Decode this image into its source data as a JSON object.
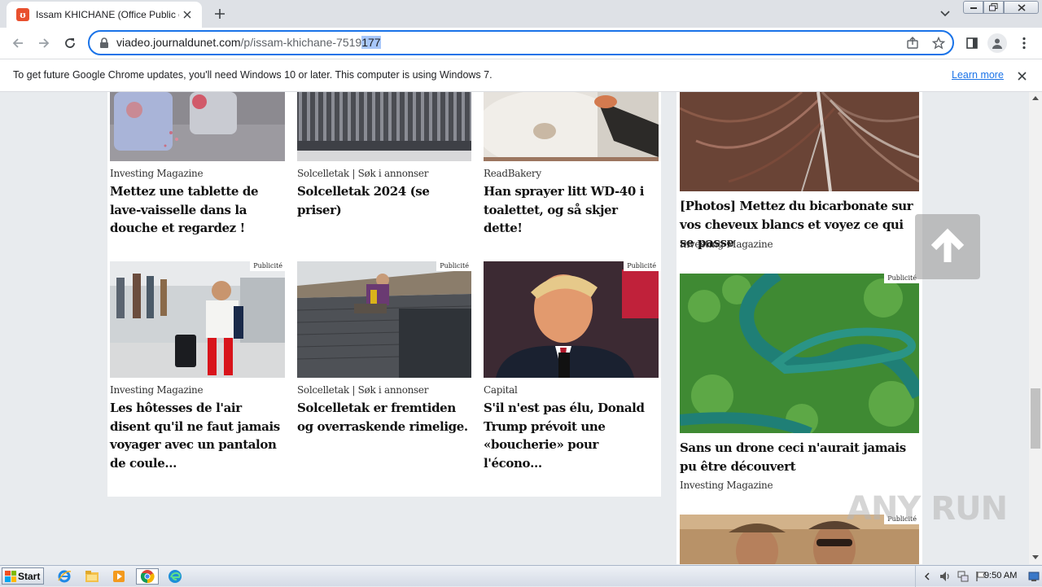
{
  "browser": {
    "tab": {
      "title": "Issam KHICHANE (Office Public de Tourisme…",
      "favicon_letter": "ʊ"
    },
    "url": {
      "host": "viadeo.journaldunet.com",
      "path_plain": "/p/issam-khichane-7519",
      "path_selected": "177"
    }
  },
  "infobar": {
    "message": "To get future Google Chrome updates, you'll need Windows 10 or later. This computer is using Windows 7.",
    "link": "Learn more"
  },
  "ads": {
    "badge": "Publicité",
    "left_row1": [
      {
        "source": "Investing Magazine",
        "headline": "Mettez une tablette de lave-vaisselle dans la douche et regardez !"
      },
      {
        "source": "Solcelletak | Søk i annonser",
        "headline": "Solcelletak 2024 (se priser)"
      },
      {
        "source": "ReadBakery",
        "headline": "Han sprayer litt WD-40 i toalettet, og så skjer dette!"
      }
    ],
    "left_row2": [
      {
        "source": "Investing Magazine",
        "headline": "Les hôtesses de l'air disent qu'il ne faut jamais voyager avec un pantalon de coule…"
      },
      {
        "source": "Solcelletak | Søk i annonser",
        "headline": "Solcelletak er fremtiden og overraskende rimelige."
      },
      {
        "source": "Capital",
        "headline": "S'il n'est pas élu, Donald Trump prévoit une «boucherie» pour l'écono…"
      }
    ],
    "right": [
      {
        "source": "Investing Magazine",
        "headline": "[Photos] Mettez du bicarbonate sur vos cheveux blancs et voyez ce qui se passe"
      },
      {
        "source": "Investing Magazine",
        "headline": "Sans un drone ceci n'aurait jamais pu être découvert"
      }
    ]
  },
  "watermark": "ANY RUN",
  "taskbar": {
    "start_label": "Start",
    "clock": "9:50 AM"
  }
}
